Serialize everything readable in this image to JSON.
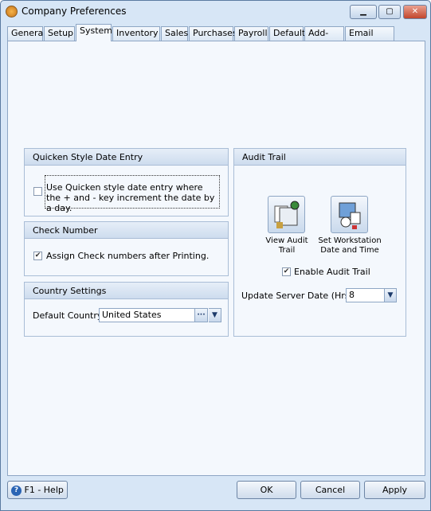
{
  "window": {
    "title": "Company Preferences",
    "minimize": "▁",
    "maximize": "▢",
    "close": "✕"
  },
  "tabs": [
    {
      "label": "General"
    },
    {
      "label": "Setup"
    },
    {
      "label": "System",
      "active": true
    },
    {
      "label": "Inventory"
    },
    {
      "label": "Sales"
    },
    {
      "label": "Purchases"
    },
    {
      "label": "Payroll"
    },
    {
      "label": "Default"
    },
    {
      "label": "Add-Ons"
    },
    {
      "label": "Email Setup"
    }
  ],
  "quicken": {
    "title": "Quicken Style Date Entry",
    "checkbox_label": "Use Quicken style date entry where the + and - key increment the date by a day.",
    "checked": false
  },
  "check_number": {
    "title": "Check Number",
    "checkbox_label": "Assign Check numbers after Printing.",
    "checked": true
  },
  "country": {
    "title": "Country Settings",
    "label": "Default Country",
    "value": "United States",
    "ellipsis": "···"
  },
  "audit": {
    "title": "Audit Trail",
    "view_label": "View Audit Trail",
    "set_label": "Set Workstation Date and Time",
    "enable_label": "Enable Audit Trail",
    "enable_checked": true,
    "update_label": "Update Server Date (Hrs)",
    "update_value": "8"
  },
  "footer": {
    "help": "F1 - Help",
    "ok": "OK",
    "cancel": "Cancel",
    "apply": "Apply"
  }
}
